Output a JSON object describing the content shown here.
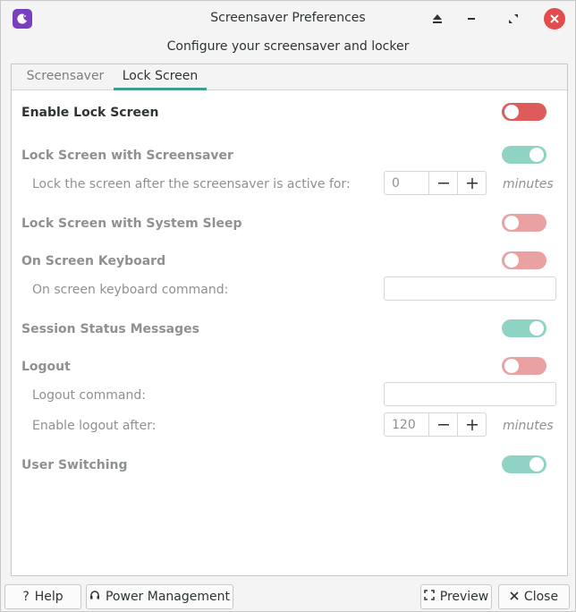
{
  "window": {
    "title": "Screensaver Preferences",
    "subtitle": "Configure your screensaver and locker"
  },
  "tabs": [
    {
      "label": "Screensaver",
      "selected": false
    },
    {
      "label": "Lock Screen",
      "selected": true
    }
  ],
  "settings": {
    "enable_lock": {
      "label": "Enable Lock Screen",
      "state": "off"
    },
    "lock_with_screensaver": {
      "label": "Lock Screen with Screensaver",
      "state": "on"
    },
    "lock_delay": {
      "label": "Lock the screen after the screensaver is active for:",
      "value": "0",
      "units": "minutes"
    },
    "lock_with_sleep": {
      "label": "Lock Screen with System Sleep",
      "state": "off"
    },
    "osk": {
      "label": "On Screen Keyboard",
      "state": "off"
    },
    "osk_command": {
      "label": "On screen keyboard command:",
      "value": ""
    },
    "session_status": {
      "label": "Session Status Messages",
      "state": "on"
    },
    "logout": {
      "label": "Logout",
      "state": "off"
    },
    "logout_command": {
      "label": "Logout command:",
      "value": ""
    },
    "logout_after": {
      "label": "Enable logout after:",
      "value": "120",
      "units": "minutes"
    },
    "user_switching": {
      "label": "User Switching",
      "state": "on"
    }
  },
  "buttons": {
    "help": "Help",
    "power": "Power Management",
    "preview": "Preview",
    "close": "Close"
  },
  "colors": {
    "accent": "#3f9e8e",
    "switch_on": "#8ed3c4",
    "switch_off_active": "#dd5b5b",
    "switch_off_inactive": "#eaa1a1",
    "app_icon": "#7a3fc1",
    "close_button": "#e34c4c"
  },
  "icons": {
    "app": "screensaver-moon-icon",
    "eject": "eject-icon",
    "minimize": "minimize-icon",
    "restore": "restore-icon",
    "close": "close-icon",
    "help": "question-icon",
    "power": "headphones-icon",
    "preview": "fullscreen-icon",
    "close_button": "x-icon"
  }
}
